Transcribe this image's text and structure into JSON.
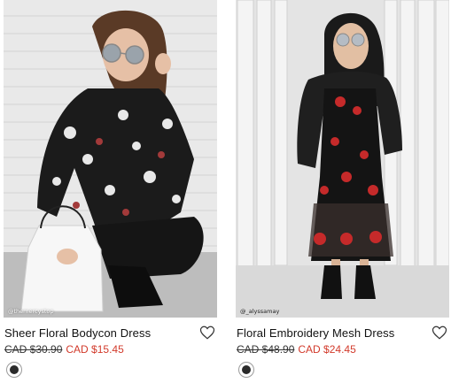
{
  "products": [
    {
      "name": "Sheer Floral Bodycon Dress",
      "original_price": "CAD $30.90",
      "sale_price": "CAD $15.45",
      "photo_credit": "@themercystop",
      "swatch_color": "#2a2a2a"
    },
    {
      "name": "Floral Embroidery Mesh Dress",
      "original_price": "CAD $48.90",
      "sale_price": "CAD $24.45",
      "photo_credit": "@_alyssamay",
      "swatch_color": "#2a2a2a"
    }
  ],
  "colors": {
    "sale_price": "#d23a2b",
    "text": "#111111"
  },
  "icons": {
    "wishlist": "heart-outline-icon"
  }
}
